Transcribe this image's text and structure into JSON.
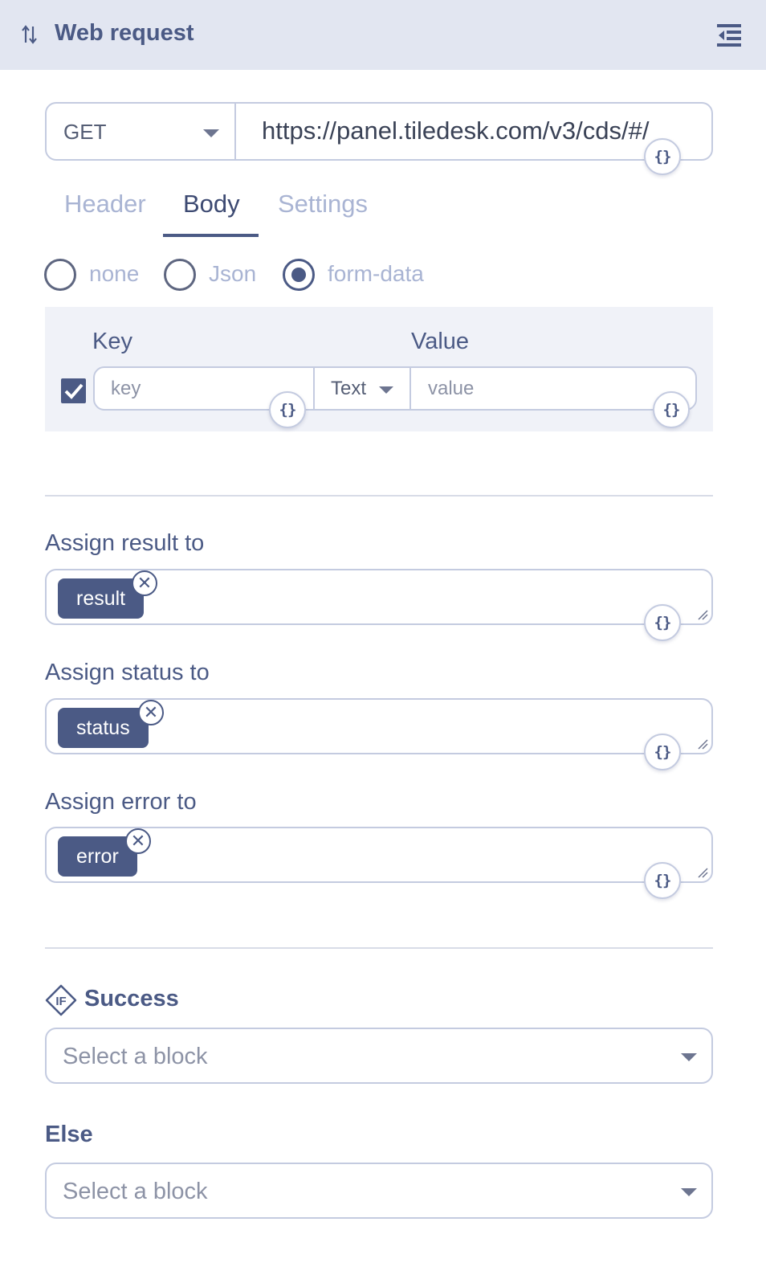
{
  "header": {
    "title": "Web request",
    "icon": "arrows-up-down-icon",
    "menu_icon": "collapse-panel-icon"
  },
  "request": {
    "method": "GET",
    "url": "https://panel.tiledesk.com/v3/cds/#/"
  },
  "variable_button_glyph": "{}",
  "tabs": [
    {
      "label": "Header",
      "active": false
    },
    {
      "label": "Body",
      "active": true
    },
    {
      "label": "Settings",
      "active": false
    }
  ],
  "body_types": [
    {
      "label": "none",
      "selected": false
    },
    {
      "label": "Json",
      "selected": false
    },
    {
      "label": "form-data",
      "selected": true
    }
  ],
  "form_data": {
    "key_header": "Key",
    "value_header": "Value",
    "row": {
      "checked": true,
      "key_placeholder": "key",
      "type": "Text",
      "value_placeholder": "value"
    }
  },
  "assign": {
    "result": {
      "label": "Assign result to",
      "chip": "result"
    },
    "status": {
      "label": "Assign status to",
      "chip": "status"
    },
    "error": {
      "label": "Assign error to",
      "chip": "error"
    }
  },
  "success": {
    "label": "Success",
    "icon": "if-condition-icon",
    "placeholder": "Select a block"
  },
  "else": {
    "label": "Else",
    "placeholder": "Select a block"
  },
  "colors": {
    "primary": "#4b5a85",
    "header_bg": "#e2e6f1",
    "border": "#c4cbe0",
    "muted_text": "#a9b4d3"
  }
}
